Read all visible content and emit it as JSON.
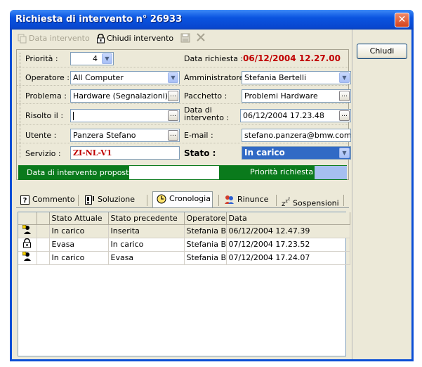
{
  "window": {
    "title": "Richiesta di intervento n° 26933",
    "close_symbol": "✕"
  },
  "toolbar": {
    "data_intervento": "Data intervento",
    "chiudi_intervento": "Chiudi intervento"
  },
  "side": {
    "chiudi": "Chiudi"
  },
  "form": {
    "priorita_label": "Priorità :",
    "priorita_value": "4",
    "data_richiesta_label": "Data richiesta :",
    "data_richiesta_value": "06/12/2004 12.27.00",
    "operatore_label": "Operatore :",
    "operatore_value": "All Computer",
    "amministratore_label": "Amministratore :",
    "amministratore_value": "Stefania Bertelli",
    "problema_label": "Problema :",
    "problema_value": "Hardware (Segnalazioni)",
    "pacchetto_label": "Pacchetto :",
    "pacchetto_value": "Problemi Hardware",
    "risolto_label": "Risolto il :",
    "risolto_value": "",
    "data_intervento_label_1": "Data di",
    "data_intervento_label_2": "intervento :",
    "data_intervento_value": "06/12/2004 17.23.48",
    "utente_label": "Utente :",
    "utente_value": "Panzera Stefano",
    "email_label": "E-mail :",
    "email_value": "stefano.panzera@bmw.com",
    "servizio_label": "Servizio :",
    "servizio_value": "ZI-NL-V1",
    "stato_label": "Stato :",
    "stato_value": "In carico",
    "data_proposta_label": "Data di intervento proposta :",
    "data_proposta_value": "",
    "priorita_richiesta_label": "Priorità richiesta :"
  },
  "colors": {
    "accent": "#316ac5",
    "green_bar": "#0a7a1c",
    "priority_swatch": "#a6bff0"
  },
  "tabs": [
    {
      "label": "Commento",
      "icon": "help-icon"
    },
    {
      "label": "Soluzione",
      "icon": "exclamation-doc-icon"
    },
    {
      "label": "Cronologia",
      "icon": "clock-icon"
    },
    {
      "label": "Rinunce",
      "icon": "people-icon"
    },
    {
      "label": "Sospensioni",
      "icon": "sleep-icon"
    }
  ],
  "grid": {
    "headers": [
      "",
      "",
      "Stato Attuale",
      "Stato precedente",
      "Operatore",
      "Data"
    ],
    "rows": [
      {
        "icon": "user-working-icon",
        "stato_attuale": "In carico",
        "stato_precedente": "Inserita",
        "operatore": "Stefania Be",
        "data": "06/12/2004 12.47.39"
      },
      {
        "icon": "lock-icon",
        "stato_attuale": "Evasa",
        "stato_precedente": "In carico",
        "operatore": "Stefania Be",
        "data": "07/12/2004 17.23.52"
      },
      {
        "icon": "user-working-icon",
        "stato_attuale": "In carico",
        "stato_precedente": "Evasa",
        "operatore": "Stefania Be",
        "data": "07/12/2004 17.24.07"
      }
    ]
  }
}
